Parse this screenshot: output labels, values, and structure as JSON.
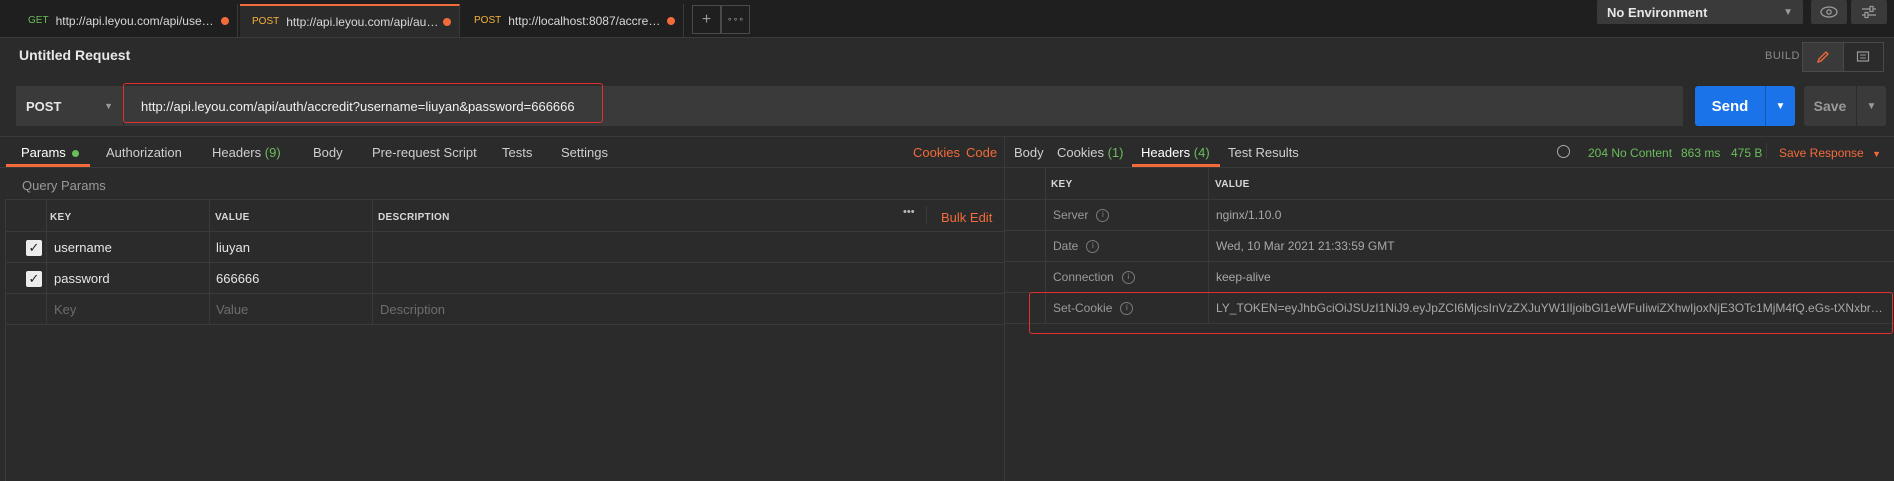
{
  "tabs": [
    {
      "method": "GET",
      "url": "http://api.leyou.com/api/user/q...",
      "unsaved": true
    },
    {
      "method": "POST",
      "url": "http://api.leyou.com/api/auth/...",
      "unsaved": true
    },
    {
      "method": "POST",
      "url": "http://localhost:8087/accredit?...",
      "unsaved": true
    }
  ],
  "tab_actions": {
    "add": "+",
    "more": "∘∘∘"
  },
  "environment": {
    "selected": "No Environment"
  },
  "request": {
    "title": "Untitled Request",
    "build_label": "BUILD",
    "method": "POST",
    "url": "http://api.leyou.com/api/auth/accredit?username=liuyan&password=666666",
    "send_label": "Send",
    "save_label": "Save"
  },
  "request_tabs": {
    "params": "Params",
    "authorization": "Authorization",
    "headers": "Headers",
    "headers_count": "(9)",
    "body": "Body",
    "prerequest": "Pre-request Script",
    "tests": "Tests",
    "settings": "Settings",
    "cookies": "Cookies",
    "code": "Code"
  },
  "params": {
    "section_title": "Query Params",
    "columns": {
      "key": "KEY",
      "value": "VALUE",
      "description": "DESCRIPTION"
    },
    "bulk_edit": "Bulk Edit",
    "more": "•••",
    "rows": [
      {
        "key": "username",
        "value": "liuyan",
        "checked": true
      },
      {
        "key": "password",
        "value": "666666",
        "checked": true
      }
    ],
    "placeholder": {
      "key": "Key",
      "value": "Value",
      "description": "Description"
    }
  },
  "response_tabs": {
    "body": "Body",
    "cookies": "Cookies",
    "cookies_count": "(1)",
    "headers": "Headers",
    "headers_count": "(4)",
    "test_results": "Test Results"
  },
  "response_status": {
    "status": "204 No Content",
    "time": "863 ms",
    "size": "475 B",
    "save_response": "Save Response"
  },
  "response_headers": {
    "columns": {
      "key": "KEY",
      "value": "VALUE"
    },
    "rows": [
      {
        "key": "Server",
        "value": "nginx/1.10.0"
      },
      {
        "key": "Date",
        "value": "Wed, 10 Mar 2021 21:33:59 GMT"
      },
      {
        "key": "Connection",
        "value": "keep-alive"
      },
      {
        "key": "Set-Cookie",
        "value": "LY_TOKEN=eyJhbGciOiJSUzI1NiJ9.eyJpZCI6MjcsInVzZXJuYW1lIjoibGl1eWFuIiwiZXhwIjoxNjE3OTc1MjM4fQ.eGs-tXNxbrL6I..."
      }
    ]
  },
  "colors": {
    "accent": "#f26b3a",
    "send": "#1a73e8",
    "success": "#6bbd5b",
    "highlight": "#e0312f"
  }
}
